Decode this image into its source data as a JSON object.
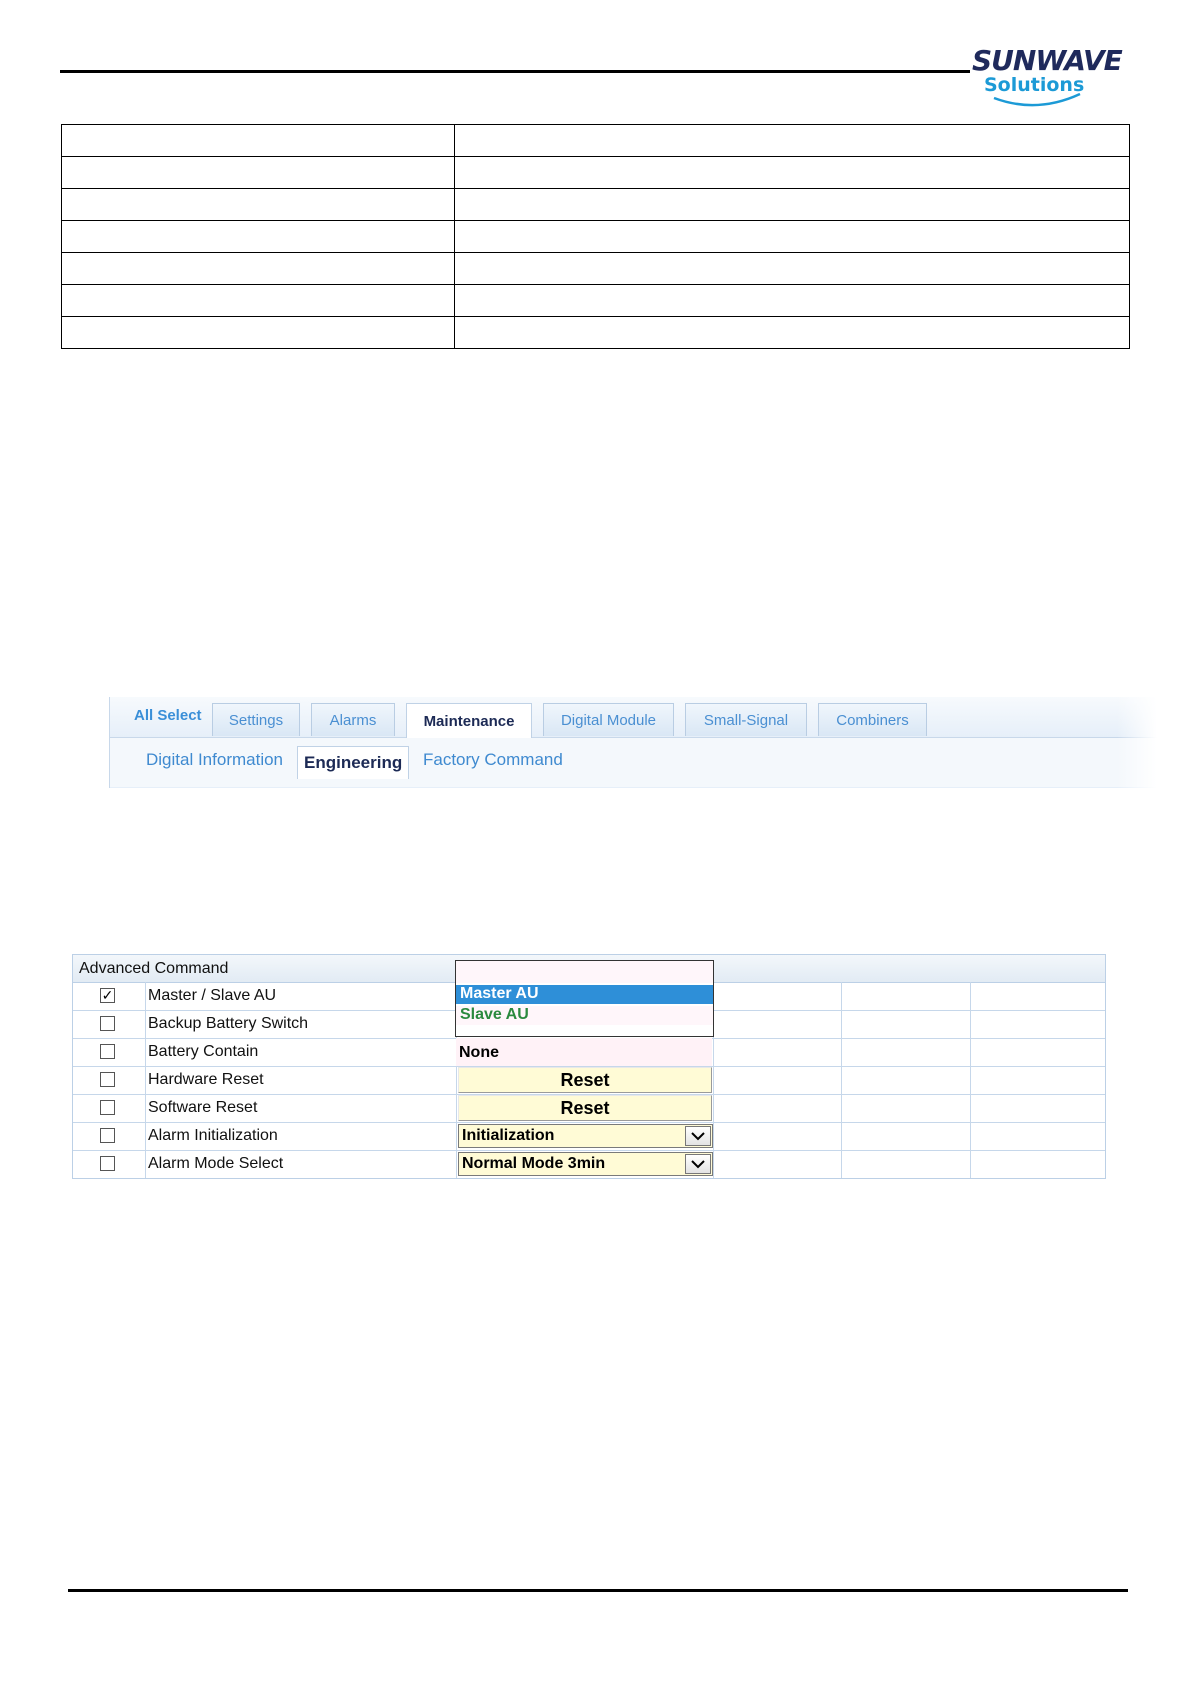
{
  "logo": {
    "brand_top": "SUNWAVE",
    "brand_bottom": "Solutions",
    "colors": {
      "navy": "#1f2a5c",
      "blue": "#1c9ad6"
    }
  },
  "blank_table": {
    "rows": 7,
    "columns": 2
  },
  "tabs": {
    "all_select": "All Select",
    "items": [
      {
        "label": "Settings"
      },
      {
        "label": "Alarms"
      },
      {
        "label": "Maintenance",
        "active": true
      },
      {
        "label": "Digital Module"
      },
      {
        "label": "Small-Signal"
      },
      {
        "label": "Combiners"
      }
    ],
    "sub_items": [
      {
        "label": "Digital Information"
      },
      {
        "label": "Engineering",
        "active": true
      },
      {
        "label": "Factory Command"
      }
    ]
  },
  "advanced": {
    "title": "Advanced Command",
    "rows": [
      {
        "checked": true,
        "label": "Master / Slave AU"
      },
      {
        "checked": false,
        "label": "Backup Battery Switch"
      },
      {
        "checked": false,
        "label": "Battery Contain",
        "value": "None"
      },
      {
        "checked": false,
        "label": "Hardware Reset",
        "button": "Reset"
      },
      {
        "checked": false,
        "label": "Software Reset",
        "button": "Reset"
      },
      {
        "checked": false,
        "label": "Alarm Initialization",
        "select": "Initialization"
      },
      {
        "checked": false,
        "label": "Alarm Mode Select",
        "select": "Normal Mode 3min"
      }
    ],
    "dropdown": {
      "options": [
        "Master AU",
        "Slave AU"
      ],
      "selected": "Master AU",
      "colors": {
        "highlight": "#2e8fd8",
        "option_text": "#2b8a3e"
      }
    },
    "checkmark": "✓"
  }
}
